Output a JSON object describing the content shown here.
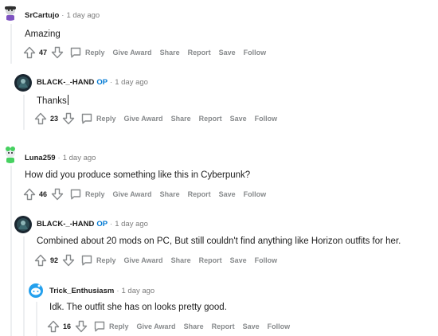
{
  "comments": [
    {
      "author": "SrCartujo",
      "time": "1 day ago",
      "body": "Amazing",
      "votes": "47",
      "actions": {
        "reply": "Reply",
        "award": "Give Award",
        "share": "Share",
        "report": "Report",
        "save": "Save",
        "follow": "Follow"
      }
    },
    {
      "author": "BLACK-_-HAND",
      "op": "OP",
      "time": "1 day ago",
      "body": "Thanks",
      "votes": "23",
      "actions": {
        "reply": "Reply",
        "award": "Give Award",
        "share": "Share",
        "report": "Report",
        "save": "Save",
        "follow": "Follow"
      }
    },
    {
      "author": "Luna259",
      "time": "1 day ago",
      "body": "How did you produce something like this in Cyberpunk?",
      "votes": "46",
      "actions": {
        "reply": "Reply",
        "award": "Give Award",
        "share": "Share",
        "report": "Report",
        "save": "Save",
        "follow": "Follow"
      }
    },
    {
      "author": "BLACK-_-HAND",
      "op": "OP",
      "time": "1 day ago",
      "body": "Combined about 20 mods on PC, But still couldn't find anything like Horizon outfits for her.",
      "votes": "92",
      "actions": {
        "reply": "Reply",
        "award": "Give Award",
        "share": "Share",
        "report": "Report",
        "save": "Save",
        "follow": "Follow"
      }
    },
    {
      "author": "Trick_Enthusiasm",
      "time": "1 day ago",
      "body": "Idk. The outfit she has on looks pretty good.",
      "votes": "16",
      "actions": {
        "reply": "Reply",
        "award": "Give Award",
        "share": "Share",
        "report": "Report",
        "save": "Save",
        "follow": "Follow"
      }
    }
  ],
  "separator": "·",
  "icons": [
    "upvote-icon",
    "downvote-icon",
    "reply-bubble-icon",
    "avatar-icon"
  ],
  "colors": {
    "op_badge": "#0079d3",
    "meta_gray": "#878a8c",
    "text": "#1c1c1c",
    "thread_line": "#edeff1"
  }
}
